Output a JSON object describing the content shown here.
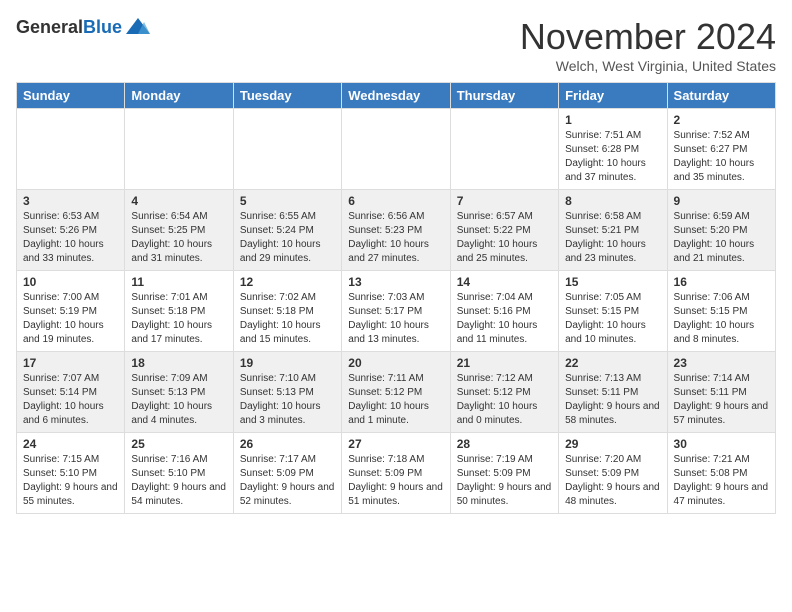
{
  "header": {
    "logo_general": "General",
    "logo_blue": "Blue",
    "month_title": "November 2024",
    "location": "Welch, West Virginia, United States"
  },
  "weekdays": [
    "Sunday",
    "Monday",
    "Tuesday",
    "Wednesday",
    "Thursday",
    "Friday",
    "Saturday"
  ],
  "weeks": [
    [
      {
        "day": "",
        "info": ""
      },
      {
        "day": "",
        "info": ""
      },
      {
        "day": "",
        "info": ""
      },
      {
        "day": "",
        "info": ""
      },
      {
        "day": "",
        "info": ""
      },
      {
        "day": "1",
        "info": "Sunrise: 7:51 AM\nSunset: 6:28 PM\nDaylight: 10 hours and 37 minutes."
      },
      {
        "day": "2",
        "info": "Sunrise: 7:52 AM\nSunset: 6:27 PM\nDaylight: 10 hours and 35 minutes."
      }
    ],
    [
      {
        "day": "3",
        "info": "Sunrise: 6:53 AM\nSunset: 5:26 PM\nDaylight: 10 hours and 33 minutes."
      },
      {
        "day": "4",
        "info": "Sunrise: 6:54 AM\nSunset: 5:25 PM\nDaylight: 10 hours and 31 minutes."
      },
      {
        "day": "5",
        "info": "Sunrise: 6:55 AM\nSunset: 5:24 PM\nDaylight: 10 hours and 29 minutes."
      },
      {
        "day": "6",
        "info": "Sunrise: 6:56 AM\nSunset: 5:23 PM\nDaylight: 10 hours and 27 minutes."
      },
      {
        "day": "7",
        "info": "Sunrise: 6:57 AM\nSunset: 5:22 PM\nDaylight: 10 hours and 25 minutes."
      },
      {
        "day": "8",
        "info": "Sunrise: 6:58 AM\nSunset: 5:21 PM\nDaylight: 10 hours and 23 minutes."
      },
      {
        "day": "9",
        "info": "Sunrise: 6:59 AM\nSunset: 5:20 PM\nDaylight: 10 hours and 21 minutes."
      }
    ],
    [
      {
        "day": "10",
        "info": "Sunrise: 7:00 AM\nSunset: 5:19 PM\nDaylight: 10 hours and 19 minutes."
      },
      {
        "day": "11",
        "info": "Sunrise: 7:01 AM\nSunset: 5:18 PM\nDaylight: 10 hours and 17 minutes."
      },
      {
        "day": "12",
        "info": "Sunrise: 7:02 AM\nSunset: 5:18 PM\nDaylight: 10 hours and 15 minutes."
      },
      {
        "day": "13",
        "info": "Sunrise: 7:03 AM\nSunset: 5:17 PM\nDaylight: 10 hours and 13 minutes."
      },
      {
        "day": "14",
        "info": "Sunrise: 7:04 AM\nSunset: 5:16 PM\nDaylight: 10 hours and 11 minutes."
      },
      {
        "day": "15",
        "info": "Sunrise: 7:05 AM\nSunset: 5:15 PM\nDaylight: 10 hours and 10 minutes."
      },
      {
        "day": "16",
        "info": "Sunrise: 7:06 AM\nSunset: 5:15 PM\nDaylight: 10 hours and 8 minutes."
      }
    ],
    [
      {
        "day": "17",
        "info": "Sunrise: 7:07 AM\nSunset: 5:14 PM\nDaylight: 10 hours and 6 minutes."
      },
      {
        "day": "18",
        "info": "Sunrise: 7:09 AM\nSunset: 5:13 PM\nDaylight: 10 hours and 4 minutes."
      },
      {
        "day": "19",
        "info": "Sunrise: 7:10 AM\nSunset: 5:13 PM\nDaylight: 10 hours and 3 minutes."
      },
      {
        "day": "20",
        "info": "Sunrise: 7:11 AM\nSunset: 5:12 PM\nDaylight: 10 hours and 1 minute."
      },
      {
        "day": "21",
        "info": "Sunrise: 7:12 AM\nSunset: 5:12 PM\nDaylight: 10 hours and 0 minutes."
      },
      {
        "day": "22",
        "info": "Sunrise: 7:13 AM\nSunset: 5:11 PM\nDaylight: 9 hours and 58 minutes."
      },
      {
        "day": "23",
        "info": "Sunrise: 7:14 AM\nSunset: 5:11 PM\nDaylight: 9 hours and 57 minutes."
      }
    ],
    [
      {
        "day": "24",
        "info": "Sunrise: 7:15 AM\nSunset: 5:10 PM\nDaylight: 9 hours and 55 minutes."
      },
      {
        "day": "25",
        "info": "Sunrise: 7:16 AM\nSunset: 5:10 PM\nDaylight: 9 hours and 54 minutes."
      },
      {
        "day": "26",
        "info": "Sunrise: 7:17 AM\nSunset: 5:09 PM\nDaylight: 9 hours and 52 minutes."
      },
      {
        "day": "27",
        "info": "Sunrise: 7:18 AM\nSunset: 5:09 PM\nDaylight: 9 hours and 51 minutes."
      },
      {
        "day": "28",
        "info": "Sunrise: 7:19 AM\nSunset: 5:09 PM\nDaylight: 9 hours and 50 minutes."
      },
      {
        "day": "29",
        "info": "Sunrise: 7:20 AM\nSunset: 5:09 PM\nDaylight: 9 hours and 48 minutes."
      },
      {
        "day": "30",
        "info": "Sunrise: 7:21 AM\nSunset: 5:08 PM\nDaylight: 9 hours and 47 minutes."
      }
    ]
  ]
}
